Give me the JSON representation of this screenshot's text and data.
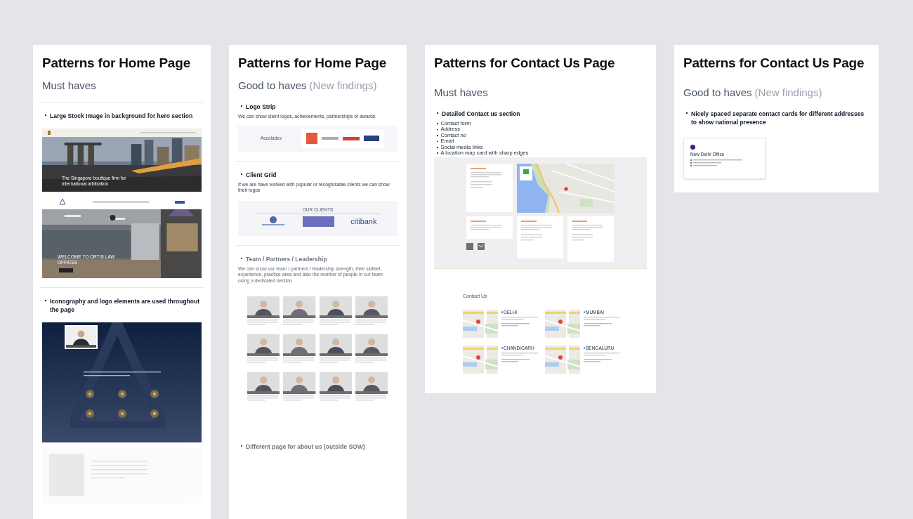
{
  "boards": [
    {
      "title": "Patterns for Home Page",
      "subtitle": "Must haves",
      "sections": [
        {
          "kind": "hero-mockups",
          "heading": "Large Stock Image in background for hero section",
          "divider_before": true,
          "faded": false,
          "hero_caption": "The Singapore boutique firm for international arbitration",
          "welcome": "WELCOME TO ORTIS LAW OFFICES"
        },
        {
          "kind": "icon-mockup",
          "heading": "Iconography and logo elements are used throughout the page",
          "divider_before": true,
          "faded": false
        }
      ]
    },
    {
      "title": "Patterns for Home Page",
      "subtitle": "Good to haves",
      "subtitle_note": "(New findings)",
      "sections": [
        {
          "kind": "logo-strip",
          "heading": "Logo Strip",
          "description": "We can show client logos, achievements, partnerships or awards.",
          "divider_before": false,
          "faded": false,
          "label": "Accolades"
        },
        {
          "kind": "client-grid",
          "heading": "Client Grid",
          "description": "If we are have worked with popular or recognisable clients we can show their logos",
          "divider_before": true,
          "faded": false,
          "label": "OUR CLIENTS",
          "logo_text": "citibank"
        },
        {
          "kind": "team-grid",
          "heading": "Team / Partners / Leadership",
          "description": "We can show our team / partners / leadership strength, their skillset, experience, practice area and also the number of people in our team using a dedicated section",
          "divider_before": true,
          "faded": true
        },
        {
          "kind": "heading-only",
          "heading": "Different page for about us (outside SOW)",
          "divider_before": false,
          "faded": true
        }
      ]
    },
    {
      "title": "Patterns for Contact Us Page",
      "subtitle": "Must haves",
      "sections": [
        {
          "kind": "contact-mockup",
          "heading": "Detailed Contact us section",
          "divider_before": false,
          "faded": false,
          "items": [
            "Contact form",
            "Address",
            "Contact no",
            "Email",
            "Social media links",
            "A location map card with sharp edges"
          ],
          "contact_title": "Contact Us",
          "offices": [
            "DELHI",
            "MUMBAI",
            "CHANDIGARH",
            "BENGALURU"
          ]
        }
      ]
    },
    {
      "title": "Patterns for Contact Us Page",
      "subtitle": "Good to haves",
      "subtitle_note": "(New findings)",
      "sections": [
        {
          "kind": "office-card",
          "heading": "Nicely spaced separate contact cards for different addresses to show national presence",
          "divider_before": false,
          "faded": false,
          "office": "New Delhi Office"
        }
      ]
    }
  ]
}
